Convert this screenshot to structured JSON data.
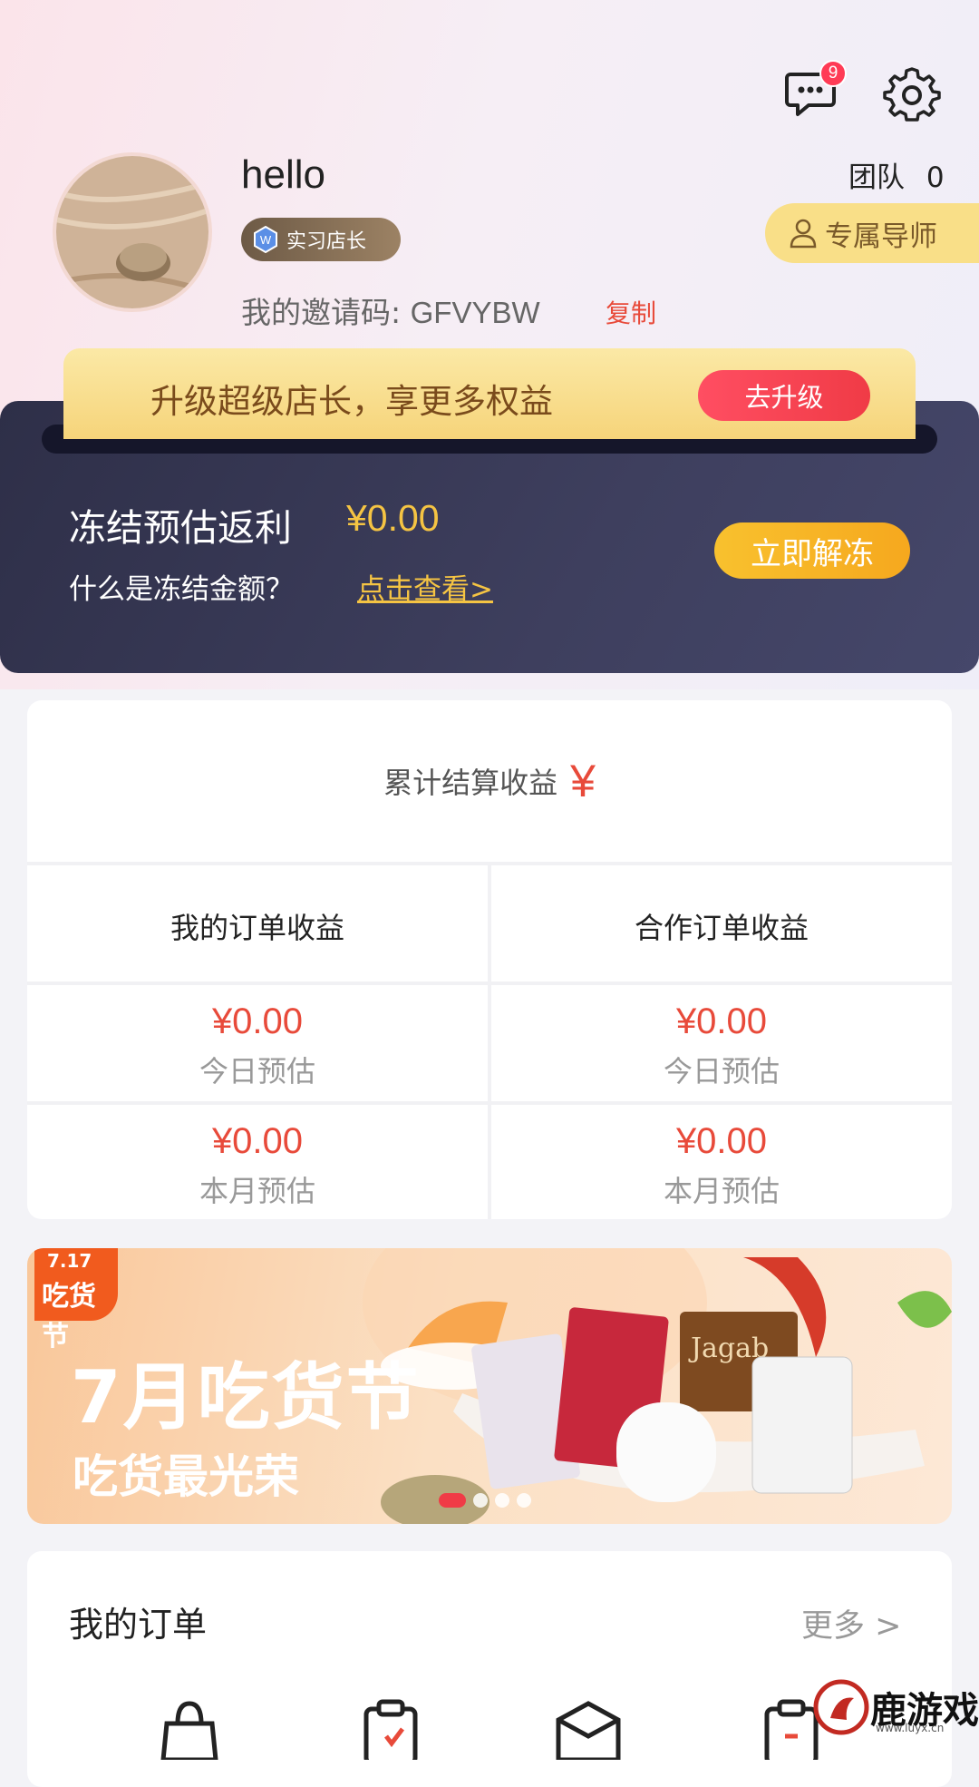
{
  "header": {
    "message_badge": "9",
    "message_icon": "chat-bubble-icon",
    "settings_icon": "gear-icon"
  },
  "profile": {
    "username": "hello",
    "level": "实习店长",
    "invite_label": "我的邀请码:",
    "invite_code": "GFVYBW",
    "copy": "复制",
    "team_label": "团队",
    "team_count": "0",
    "mentor": "专属导师"
  },
  "upgrade": {
    "text": "升级超级店长，享更多权益",
    "button": "去升级"
  },
  "frozen": {
    "title": "冻结预估返利",
    "amount": "¥0.00",
    "question": "什么是冻结金额？",
    "link": "点击查看>",
    "button": "立即解冻"
  },
  "earnings": {
    "title": "累计结算收益",
    "yen": "¥",
    "columns": [
      {
        "title": "我的订单收益",
        "today": "¥0.00",
        "today_label": "今日预估",
        "month": "¥0.00",
        "month_label": "本月预估"
      },
      {
        "title": "合作订单收益",
        "today": "¥0.00",
        "today_label": "今日预估",
        "month": "¥0.00",
        "month_label": "本月预估"
      }
    ]
  },
  "promo": {
    "logo_date": "7.17",
    "logo_name": "吃货节",
    "title": "7月吃货节",
    "subtitle": "吃货最光荣",
    "product_text": "Jagab"
  },
  "orders": {
    "title": "我的订单",
    "more": "更多 >"
  },
  "watermark": {
    "name": "鹿游戏",
    "url": "www.luyx.cn"
  },
  "colors": {
    "accent_red": "#e84a3a",
    "gold": "#f5c443",
    "dark_card": "#34354f"
  }
}
